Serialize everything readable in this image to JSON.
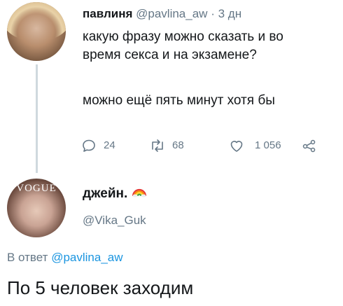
{
  "tweet1": {
    "author_name": "павлиня",
    "handle": "@pavlina_aw",
    "separator": "·",
    "time": "3 дн",
    "text_line1": "какую фразу можно сказать и во",
    "text_line2": "время секса и на экзамене?",
    "text_line3": "можно ещё пять минут хотя бы",
    "metrics": {
      "replies": "24",
      "retweets": "68",
      "likes": "1 056"
    }
  },
  "tweet2": {
    "author_name": "джейн.",
    "handle": "@Vika_Guk",
    "avatar_overlay": "VOGUE",
    "reply_prefix": "В ответ",
    "reply_to": "@pavlina_aw",
    "text": "По 5 человек заходим"
  },
  "colors": {
    "muted": "#657786",
    "link": "#1b95e0",
    "thread_line": "#cfd9de"
  }
}
